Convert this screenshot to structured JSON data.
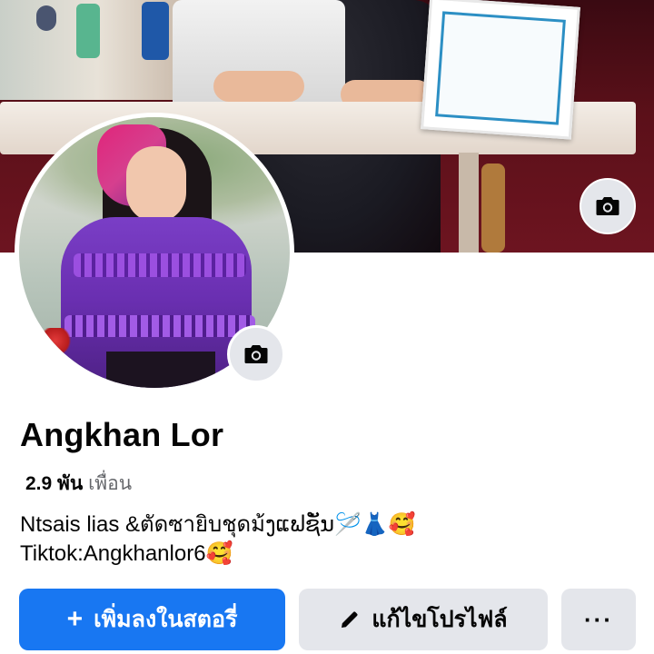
{
  "profile": {
    "name": "Angkhan Lor",
    "friends_count": "2.9 พัน",
    "friends_label": "เพื่อน",
    "bio_line1": "Ntsais lias &ตัดซายิบชุดม้ງແຟຊັ່ນ🪡👗🥰",
    "bio_line2": "Tiktok:Angkhanlor6🥰"
  },
  "actions": {
    "add_story_label": "เพิ่มลงในสตอรี่",
    "edit_profile_label": "แก้ไขโปรไฟล์",
    "more_label": "···"
  },
  "icons": {
    "cover_camera": "camera-icon",
    "avatar_camera": "camera-icon",
    "add_story": "plus-icon",
    "edit_profile": "pencil-icon",
    "more": "more-dots-icon"
  },
  "colors": {
    "primary_button": "#1877f2",
    "secondary_button": "#e4e6eb",
    "secondary_text": "#65676b"
  }
}
